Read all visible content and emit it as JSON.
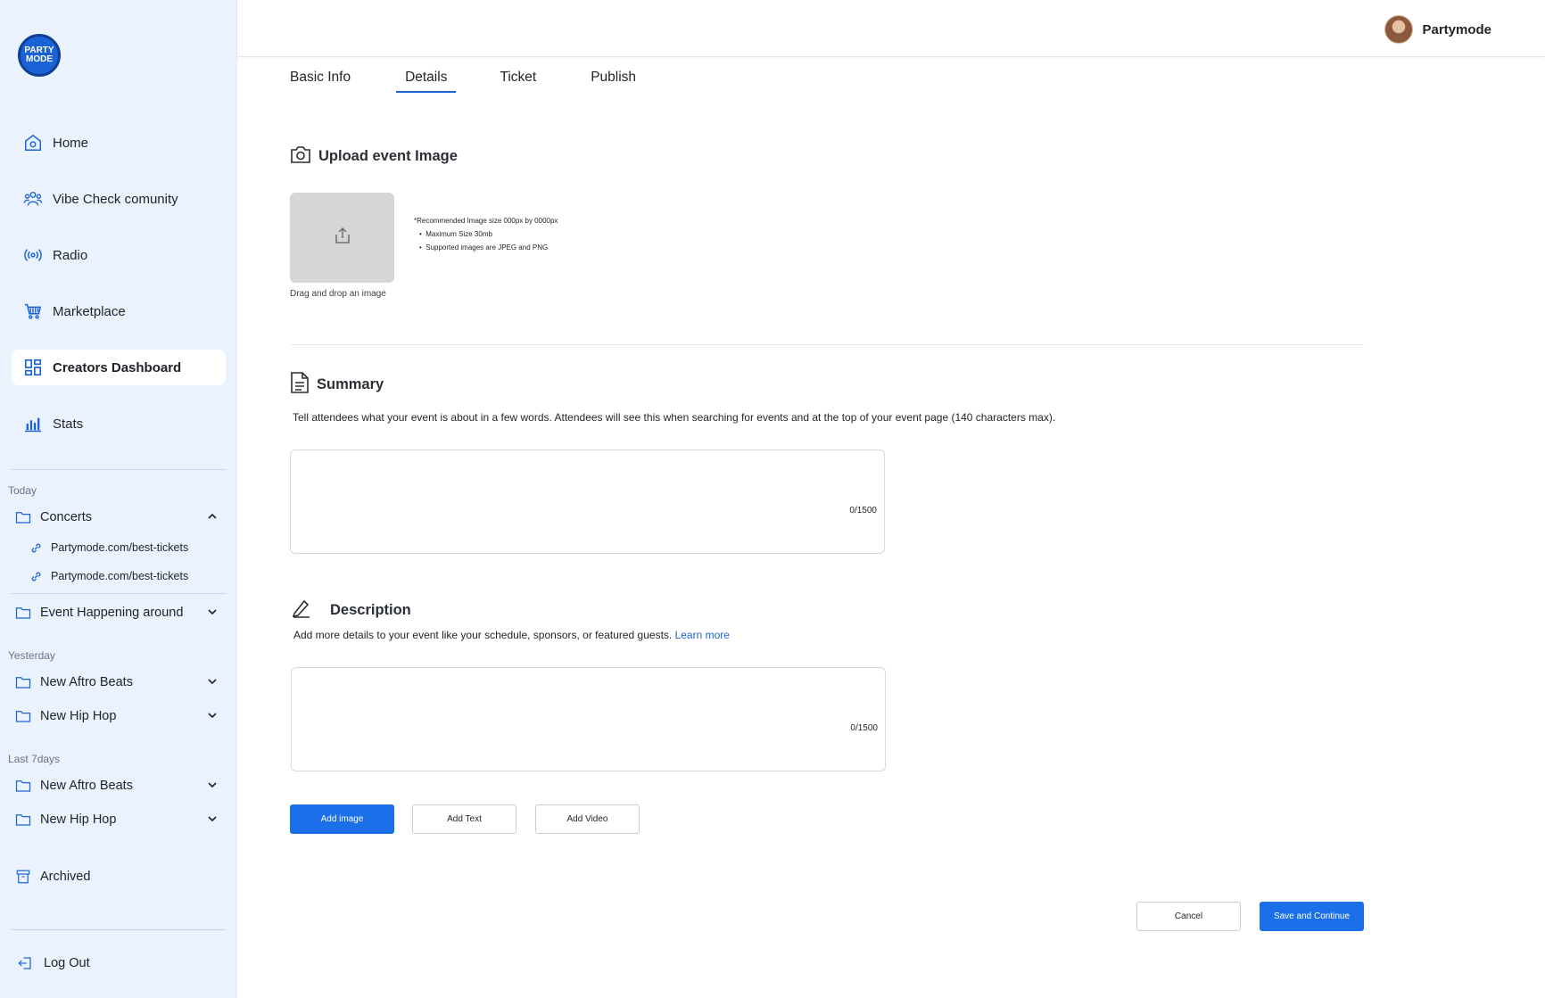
{
  "brand": {
    "logo_line1": "PARTY",
    "logo_line2": "MODE"
  },
  "sidebar": {
    "nav": [
      {
        "label": "Home",
        "icon": "home-icon"
      },
      {
        "label": "Vibe Check comunity",
        "icon": "community-icon"
      },
      {
        "label": "Radio",
        "icon": "radio-icon"
      },
      {
        "label": "Marketplace",
        "icon": "cart-icon"
      },
      {
        "label": "Creators Dashboard",
        "icon": "dashboard-icon",
        "active": true
      },
      {
        "label": "Stats",
        "icon": "stats-icon"
      }
    ],
    "groups": {
      "today": "Today",
      "yesterday": "Yesterday",
      "last7": "Last 7days"
    },
    "folders": [
      {
        "label": "Concerts",
        "expanded": true
      },
      {
        "label": "Event Happening around"
      },
      {
        "label": "New Aftro Beats"
      },
      {
        "label": "New Hip Hop"
      },
      {
        "label": "New Aftro Beats"
      },
      {
        "label": "New Hip Hop"
      }
    ],
    "links": [
      "Partymode.com/best-tickets",
      "Partymode.com/best-tickets"
    ],
    "archived": "Archived",
    "logout": "Log Out"
  },
  "header": {
    "username": "Partymode"
  },
  "tabs": [
    {
      "label": "Basic Info"
    },
    {
      "label": "Details",
      "active": true
    },
    {
      "label": "Ticket"
    },
    {
      "label": "Publish"
    }
  ],
  "upload": {
    "title": "Upload event Image",
    "hint": "Drag and drop an image",
    "req_title": "*Recommended Image size 000px by 0000px",
    "req_items": [
      "Maximum Size 30mb",
      "Supported images are JPEG and PNG"
    ]
  },
  "summary": {
    "title": "Summary",
    "text": "Tell attendees what your event is about in a few words. Attendees will see this when searching for events and at the top of your event page (140 characters max).",
    "counter": "0/1500"
  },
  "description": {
    "title": "Description",
    "text": "Add more details to your event like your schedule, sponsors, or featured guests.",
    "link": "Learn more",
    "counter": "0/1500"
  },
  "actions": {
    "add_image": "Add image",
    "add_text": "Add Text",
    "add_video": "Add Video",
    "cancel": "Cancel",
    "save": "Save and Continue"
  },
  "colors": {
    "accent": "#1b6fe8",
    "sidebar_bg": "#eaf2fe"
  }
}
